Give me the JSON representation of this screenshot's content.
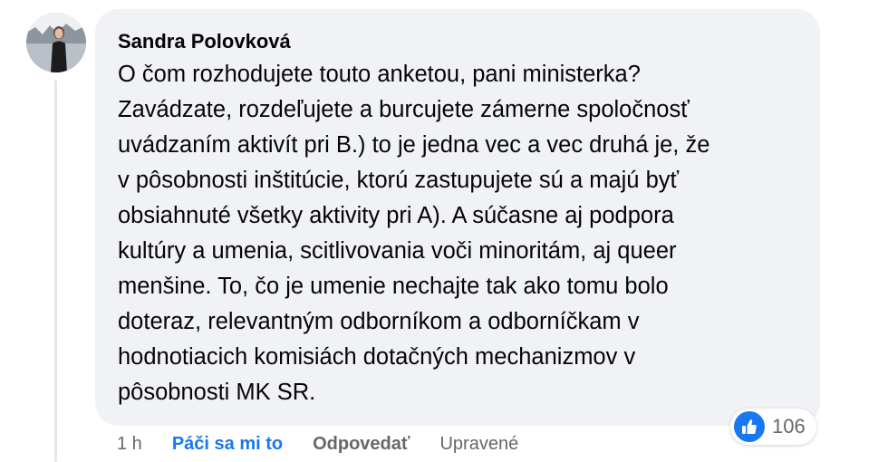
{
  "comment": {
    "author": "Sandra Polovková",
    "lines": [
      "O čom rozhodujete touto anketou, pani ministerka?",
      "Zavádzate, rozdeľujete a burcujete zámerne spoločnosť",
      "uvádzaním aktivít pri B.) to je jedna vec a vec druhá je, že",
      "v pôsobnosti inštitúcie, ktorú zastupujete sú a majú byť",
      "obsiahnuté všetky aktivity pri A). A súčasne aj podpora",
      "kultúry a umenia, scitlivovania voči minoritám, aj queer",
      "menšine. To, čo je umenie nechajte tak ako tomu bolo",
      "doteraz, relevantným odborníkom a odborníčkam v",
      "hodnotiacich komisiách dotačných mechanizmov v",
      "pôsobnosti MK SR."
    ]
  },
  "reactions": {
    "icon": "thumbs-up-icon",
    "count": "106",
    "color": "#1877f2"
  },
  "actions": {
    "time": "1 h",
    "like_label": "Páči sa mi to",
    "reply_label": "Odpovedať",
    "edited_label": "Upravené"
  },
  "colors": {
    "bubble": "#f0f2f5",
    "accent": "#1877f2",
    "muted": "#65676b"
  }
}
